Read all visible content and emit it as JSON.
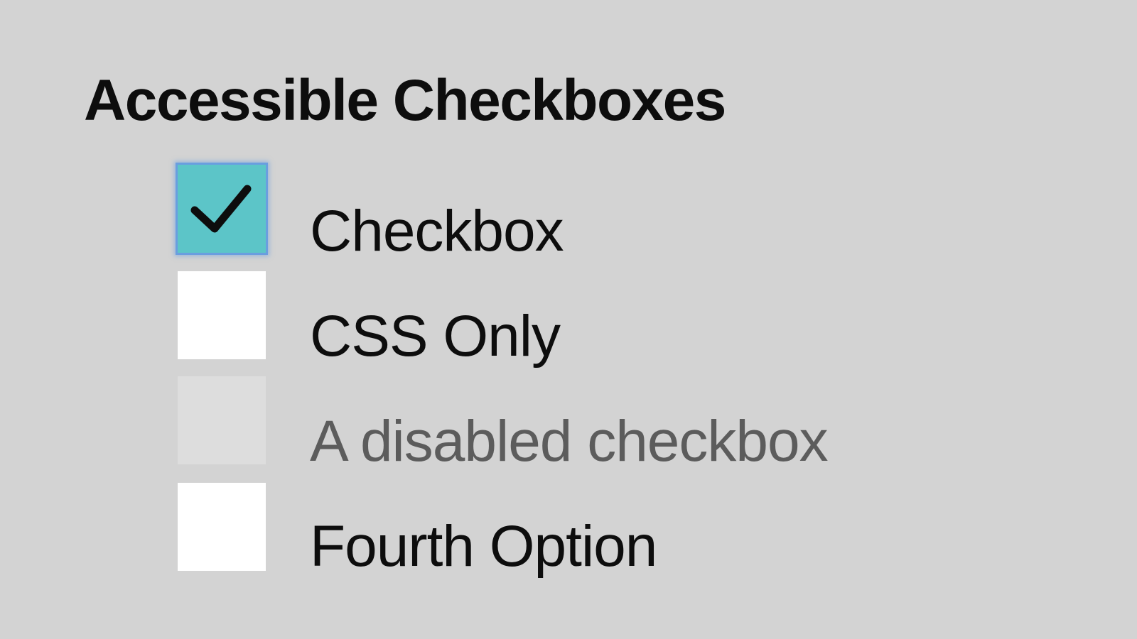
{
  "page": {
    "title": "Accessible Checkboxes",
    "background": "#d3d3d3"
  },
  "checkboxes": [
    {
      "label": "Checkbox",
      "checked": true,
      "disabled": false,
      "focused": true,
      "icon": "checkmark-icon"
    },
    {
      "label": "CSS Only",
      "checked": false,
      "disabled": false,
      "focused": false
    },
    {
      "label": "A disabled checkbox",
      "checked": false,
      "disabled": true,
      "focused": false
    },
    {
      "label": "Fourth Option",
      "checked": false,
      "disabled": false,
      "focused": false
    }
  ],
  "colors": {
    "checked_fill": "#5cc5c8",
    "focus_ring": "#6a9edf",
    "unchecked_fill": "#ffffff",
    "disabled_fill": "#dddddd",
    "disabled_text": "#5c5c5c"
  }
}
